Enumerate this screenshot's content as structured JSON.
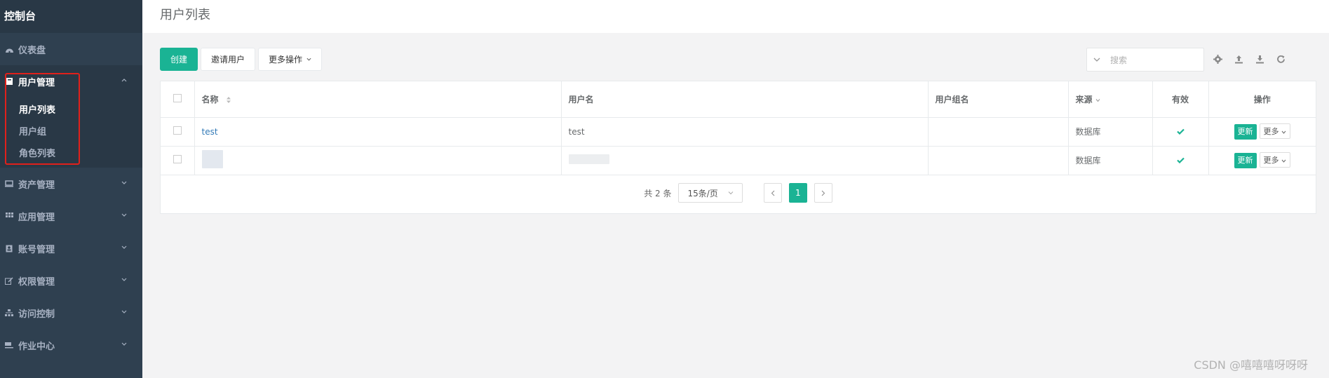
{
  "sidebar": {
    "brand": "控制台",
    "items": [
      {
        "label": "仪表盘",
        "icon": "dashboard-icon"
      },
      {
        "label": "用户管理",
        "icon": "user-icon",
        "expanded": true,
        "children": [
          {
            "label": "用户列表",
            "current": true
          },
          {
            "label": "用户组"
          },
          {
            "label": "角色列表"
          }
        ]
      },
      {
        "label": "资产管理",
        "icon": "monitor-icon"
      },
      {
        "label": "应用管理",
        "icon": "grid-icon"
      },
      {
        "label": "账号管理",
        "icon": "contact-icon"
      },
      {
        "label": "权限管理",
        "icon": "edit-icon"
      },
      {
        "label": "访问控制",
        "icon": "sitemap-icon"
      },
      {
        "label": "作业中心",
        "icon": "coffee-icon"
      }
    ]
  },
  "header": {
    "title": "用户列表"
  },
  "toolbar": {
    "create": "创建",
    "invite": "邀请用户",
    "more_actions": "更多操作",
    "search_placeholder": "搜索"
  },
  "table": {
    "columns": [
      "名称",
      "用户名",
      "用户组名",
      "来源",
      "有效",
      "操作"
    ],
    "rows": [
      {
        "name": "test",
        "username": "test",
        "group": "",
        "source": "数据库",
        "active": true,
        "update": "更新",
        "more": "更多"
      },
      {
        "name": "",
        "username": "",
        "group": "",
        "source": "数据库",
        "active": true,
        "update": "更新",
        "more": "更多"
      }
    ]
  },
  "pagination": {
    "total": "共 2 条",
    "page_size": "15条/页",
    "current_page": "1"
  },
  "watermark": "CSDN @嘻嘻嘻呀呀呀",
  "colors": {
    "sidebar": "#2f4050",
    "accent": "#1ab394",
    "highlight": "#e0201b"
  }
}
